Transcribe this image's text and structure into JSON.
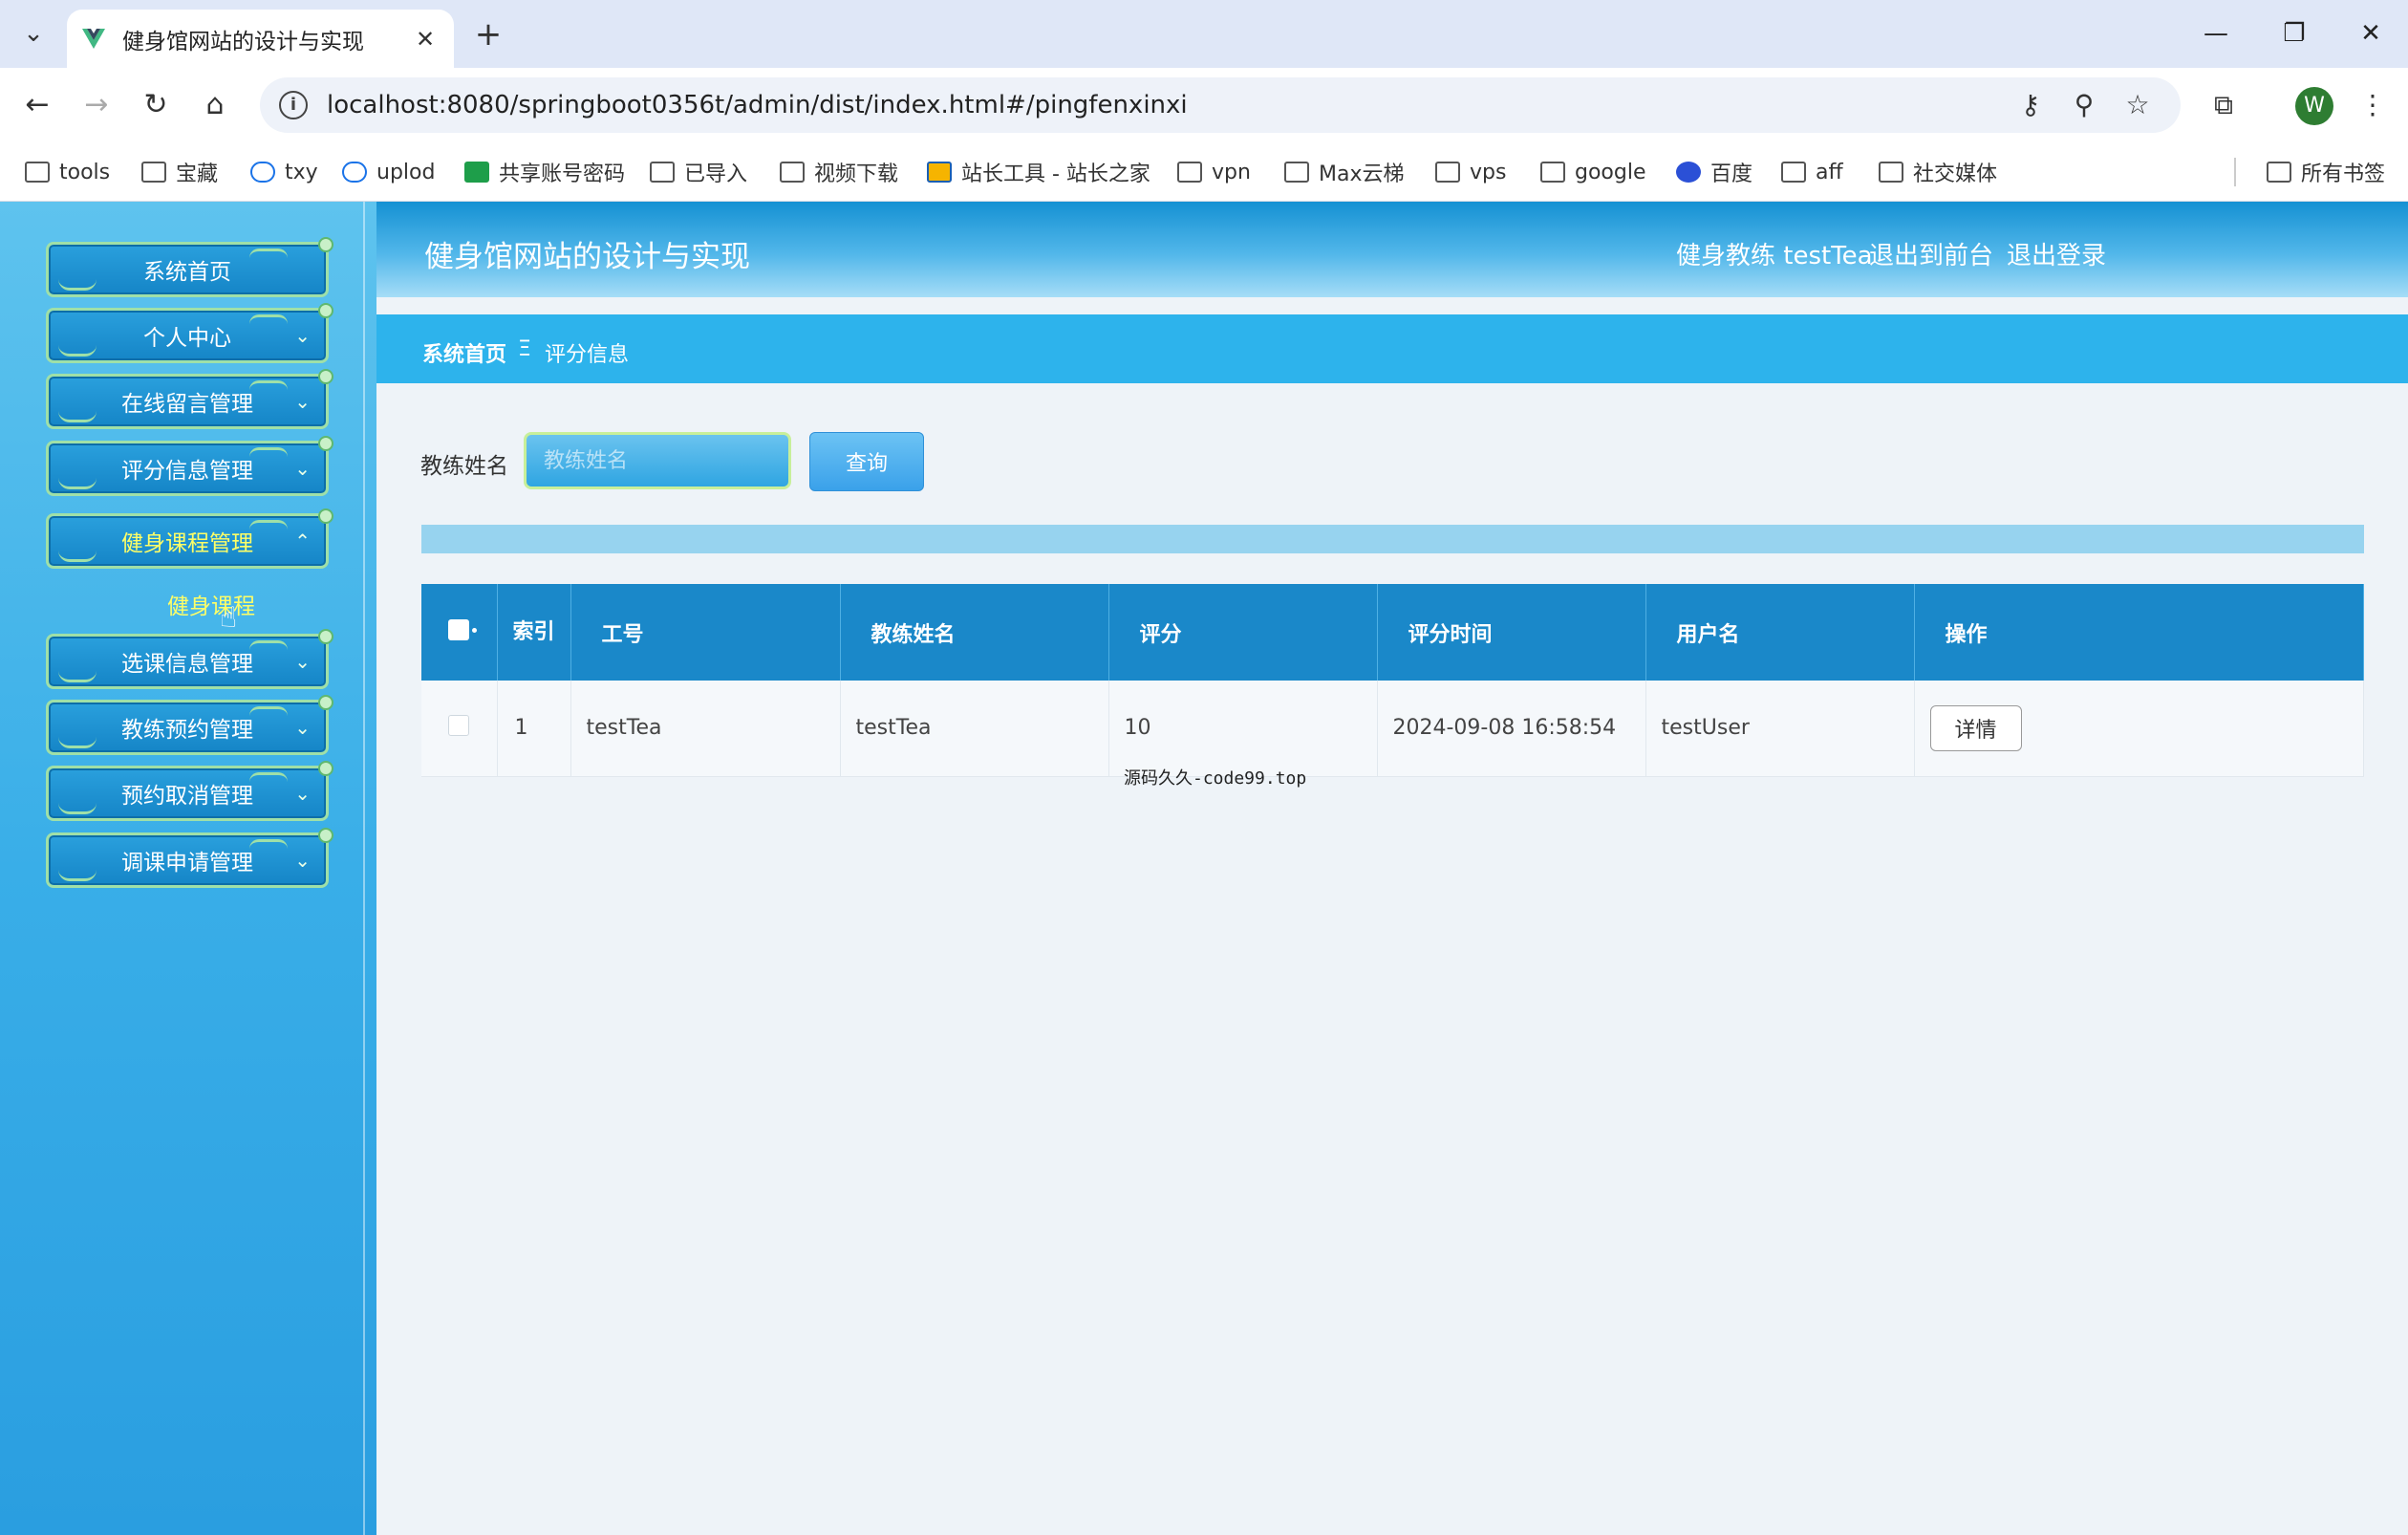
{
  "browser": {
    "tab_title": "健身馆网站的设计与实现",
    "url": "localhost:8080/springboot0356t/admin/dist/index.html#/pingfenxinxi",
    "profile_initial": "W",
    "bookmarks": [
      "tools",
      "宝藏",
      "txy",
      "uplod",
      "共享账号密码",
      "已导入",
      "视频下载",
      "站长工具 - 站长之家",
      "vpn",
      "Max云梯",
      "vps",
      "google",
      "百度",
      "aff",
      "社交媒体"
    ],
    "all_bookmarks": "所有书签"
  },
  "header": {
    "title": "健身馆网站的设计与实现",
    "user": "健身教练 testTea",
    "to_front": "退出到前台",
    "logout": "退出登录"
  },
  "sidebar": {
    "items": [
      "系统首页",
      "个人中心",
      "在线留言管理",
      "评分信息管理",
      "健身课程管理",
      "选课信息管理",
      "教练预约管理",
      "预约取消管理",
      "调课申请管理"
    ],
    "submenu": "健身课程"
  },
  "breadcrumb": {
    "home": "系统首页",
    "separator": "Ξ",
    "current": "评分信息"
  },
  "search": {
    "label": "教练姓名",
    "placeholder": "教练姓名",
    "button": "查询"
  },
  "table": {
    "columns": [
      "索引",
      "工号",
      "教练姓名",
      "评分",
      "评分时间",
      "用户名",
      "操作"
    ],
    "rows": [
      {
        "index": "1",
        "id": "testTea",
        "name": "testTea",
        "score": "10",
        "time": "2024-09-08 16:58:54",
        "user": "testUser",
        "action": "详情"
      }
    ]
  },
  "watermark": "源码久久-code99.top",
  "colors": {
    "header": "#1591d3",
    "sidebar": "#39aee8",
    "table_header": "#1a88c9",
    "active_menu": "#ffff66"
  }
}
